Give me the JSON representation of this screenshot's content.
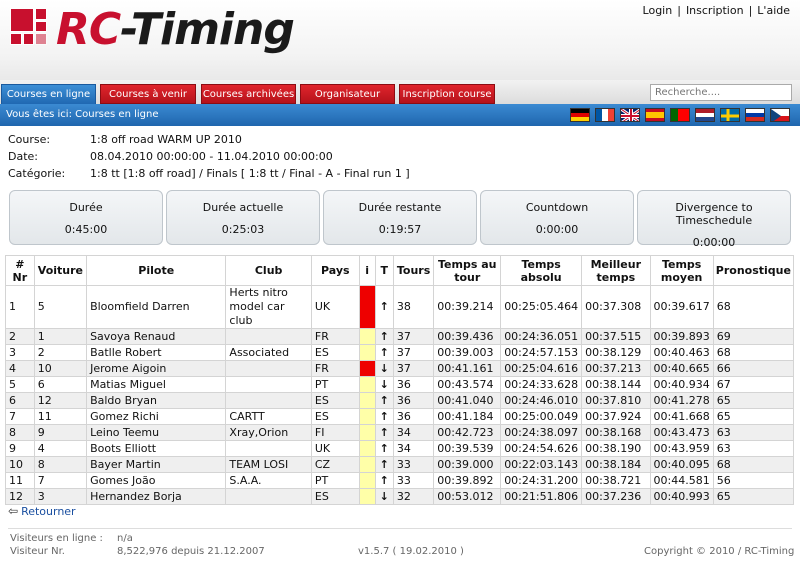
{
  "header": {
    "logo_prefix": "RC",
    "logo_suffix": "-Timing",
    "links": {
      "login": "Login",
      "register": "Inscription",
      "help": "L'aide"
    }
  },
  "nav": {
    "tabs": [
      {
        "label": "Courses en ligne",
        "active": true
      },
      {
        "label": "Courses à venir"
      },
      {
        "label": "Courses archivées"
      },
      {
        "label": "Organisateur"
      },
      {
        "label": "Inscription course"
      }
    ],
    "search_placeholder": "Recherche...."
  },
  "breadcrumb": "Vous êtes ici: Courses en ligne",
  "languages": [
    "de",
    "fr",
    "en",
    "es",
    "pt",
    "nl",
    "sv",
    "ru",
    "cz"
  ],
  "race": {
    "course_label": "Course:",
    "course": "1:8 off road WARM UP 2010",
    "date_label": "Date:",
    "date": "08.04.2010 00:00:00 - 11.04.2010 00:00:00",
    "category_label": "Catégorie:",
    "category": "1:8 tt [1:8 off road] / Finals [ 1:8 tt / Final - A - Final run 1 ]"
  },
  "timers": [
    {
      "label": "Durée",
      "value": "0:45:00"
    },
    {
      "label": "Durée actuelle",
      "value": "0:25:03"
    },
    {
      "label": "Durée restante",
      "value": "0:19:57"
    },
    {
      "label": "Countdown",
      "value": "0:00:00"
    },
    {
      "label": "Divergence to Timeschedule",
      "value": "0:00:00"
    }
  ],
  "table": {
    "headers": [
      "# Nr",
      "Voiture",
      "Pilote",
      "Club",
      "Pays",
      "i",
      "T",
      "Tours",
      "Temps au tour",
      "Temps absolu",
      "Meilleur temps",
      "Temps moyen",
      "Pronostique"
    ],
    "rows": [
      {
        "pos": "1",
        "car": "5",
        "driver": "Bloomfield Darren",
        "club": "Herts nitro model car club",
        "country": "UK",
        "status": "red",
        "trend": "up",
        "laps": "38",
        "lap": "00:39.214",
        "abs": "00:25:05.464",
        "best": "00:37.308",
        "avg": "00:39.617",
        "prog": "68"
      },
      {
        "pos": "2",
        "car": "1",
        "driver": "Savoya Renaud",
        "club": "",
        "country": "FR",
        "status": "yellow",
        "trend": "up",
        "laps": "37",
        "lap": "00:39.436",
        "abs": "00:24:36.051",
        "best": "00:37.515",
        "avg": "00:39.893",
        "prog": "69"
      },
      {
        "pos": "3",
        "car": "2",
        "driver": "Batlle Robert",
        "club": "Associated",
        "country": "ES",
        "status": "yellow",
        "trend": "up",
        "laps": "37",
        "lap": "00:39.003",
        "abs": "00:24:57.153",
        "best": "00:38.129",
        "avg": "00:40.463",
        "prog": "68"
      },
      {
        "pos": "4",
        "car": "10",
        "driver": "Jerome Aigoin",
        "club": "",
        "country": "FR",
        "status": "red",
        "trend": "down",
        "laps": "37",
        "lap": "00:41.161",
        "abs": "00:25:04.616",
        "best": "00:37.213",
        "avg": "00:40.665",
        "prog": "66"
      },
      {
        "pos": "5",
        "car": "6",
        "driver": "Matias Miguel",
        "club": "",
        "country": "PT",
        "status": "yellow",
        "trend": "down",
        "laps": "36",
        "lap": "00:43.574",
        "abs": "00:24:33.628",
        "best": "00:38.144",
        "avg": "00:40.934",
        "prog": "67"
      },
      {
        "pos": "6",
        "car": "12",
        "driver": "Baldo Bryan",
        "club": "",
        "country": "ES",
        "status": "yellow",
        "trend": "up",
        "laps": "36",
        "lap": "00:41.040",
        "abs": "00:24:46.010",
        "best": "00:37.810",
        "avg": "00:41.278",
        "prog": "65"
      },
      {
        "pos": "7",
        "car": "11",
        "driver": "Gomez Richi",
        "club": "CARTT",
        "country": "ES",
        "status": "yellow",
        "trend": "up",
        "laps": "36",
        "lap": "00:41.184",
        "abs": "00:25:00.049",
        "best": "00:37.924",
        "avg": "00:41.668",
        "prog": "65"
      },
      {
        "pos": "8",
        "car": "9",
        "driver": "Leino Teemu",
        "club": "Xray,Orion",
        "country": "FI",
        "status": "yellow",
        "trend": "up",
        "laps": "34",
        "lap": "00:42.723",
        "abs": "00:24:38.097",
        "best": "00:38.168",
        "avg": "00:43.473",
        "prog": "63"
      },
      {
        "pos": "9",
        "car": "4",
        "driver": "Boots Elliott",
        "club": "",
        "country": "UK",
        "status": "yellow",
        "trend": "up",
        "laps": "34",
        "lap": "00:39.539",
        "abs": "00:24:54.626",
        "best": "00:38.190",
        "avg": "00:43.959",
        "prog": "63"
      },
      {
        "pos": "10",
        "car": "8",
        "driver": "Bayer Martin",
        "club": "TEAM LOSI",
        "country": "CZ",
        "status": "yellow",
        "trend": "up",
        "laps": "33",
        "lap": "00:39.000",
        "abs": "00:22:03.143",
        "best": "00:38.184",
        "avg": "00:40.095",
        "prog": "68"
      },
      {
        "pos": "11",
        "car": "7",
        "driver": "Gomes João",
        "club": "S.A.A.",
        "country": "PT",
        "status": "yellow",
        "trend": "up",
        "laps": "33",
        "lap": "00:39.892",
        "abs": "00:24:31.200",
        "best": "00:38.721",
        "avg": "00:44.581",
        "prog": "56"
      },
      {
        "pos": "12",
        "car": "3",
        "driver": "Hernandez Borja",
        "club": "",
        "country": "ES",
        "status": "yellow",
        "trend": "down",
        "laps": "32",
        "lap": "00:53.012",
        "abs": "00:21:51.806",
        "best": "00:37.236",
        "avg": "00:40.993",
        "prog": "65"
      }
    ]
  },
  "footer": {
    "back": "Retourner",
    "visitors_online_label": "Visiteurs en ligne :",
    "visitors_online": "n/a",
    "visitor_nr_label": "Visiteur Nr.",
    "visitor_nr": "8,522,976 depuis 21.12.2007",
    "version": "v1.5.7 ( 19.02.2010 )",
    "copyright": "Copyright © 2010 / RC-Timing"
  },
  "colors": {
    "brand_red": "#c8102e",
    "nav_blue": "#1f66ae",
    "status_red": "#ee0000",
    "status_yellow": "#ffffa8"
  }
}
